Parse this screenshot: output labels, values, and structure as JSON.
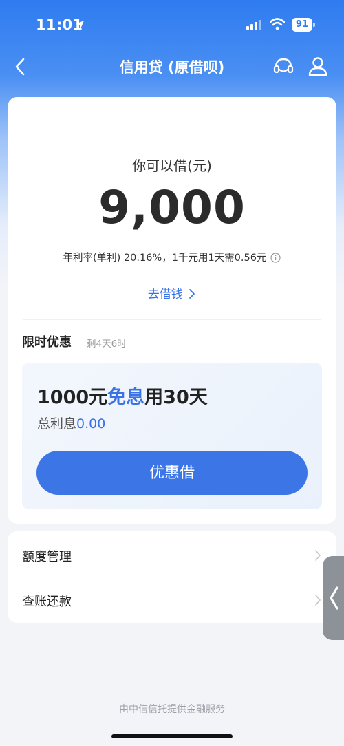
{
  "status_bar": {
    "time": "11:01",
    "battery": "91"
  },
  "nav": {
    "title": "信用贷 (原借呗)"
  },
  "main": {
    "borrow_label": "你可以借(元)",
    "amount": "9,000",
    "rate_text": "年利率(单利) 20.16%，1千元用1天需0.56元",
    "go_borrow": "去借钱",
    "promo": {
      "title": "限时优惠",
      "remaining": "剩4天6时",
      "headline_prefix": "1000元",
      "headline_accent": "免息",
      "headline_suffix": "用30天",
      "interest_label": "总利息",
      "interest_value": "0.00",
      "button": "优惠借"
    }
  },
  "menu": [
    {
      "label": "额度管理"
    },
    {
      "label": "查账还款"
    }
  ],
  "footer": "由中信信托提供金融服务",
  "colors": {
    "accent": "#3a73e8",
    "header_blue": "#2f7cf0"
  }
}
